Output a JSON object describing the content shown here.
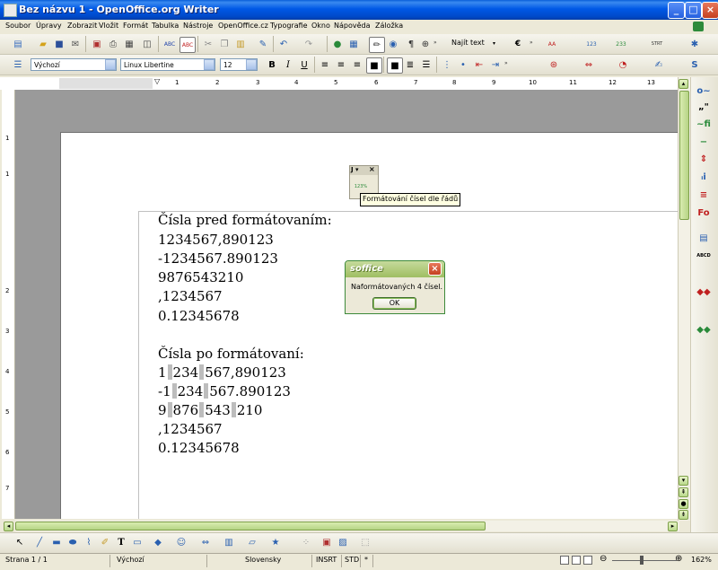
{
  "window": {
    "title": "Bez názvu 1 - OpenOffice.org Writer",
    "controls": [
      "_",
      "□",
      "×"
    ]
  },
  "menu": [
    "Soubor",
    "Úpravy",
    "Zobrazit",
    "Vložit",
    "Formát",
    "Tabulka",
    "Nástroje",
    "OpenOffice.cz",
    "Typografie",
    "Okno",
    "Nápověda",
    "Záložka"
  ],
  "toolbar": {
    "find_text": "Najít text",
    "paragraph_style": "Výchozí",
    "font_name": "Linux Libertine",
    "font_size": "12",
    "bold": "B",
    "italic": "I",
    "underline": "U"
  },
  "ruler": {
    "numbers": [
      "1",
      "2",
      "3",
      "4",
      "5",
      "6",
      "7",
      "8",
      "9",
      "10",
      "11",
      "12",
      "13"
    ],
    "vnumbers": [
      "1",
      "1",
      "2",
      "3",
      "4",
      "5",
      "6",
      "7"
    ]
  },
  "document": {
    "heading_before": "Čísla pred formátovaním:",
    "before": [
      "1234567,890123",
      "-1234567.890123",
      "9876543210",
      ",1234567",
      "0.12345678"
    ],
    "heading_after": "Čísla po formátovaní:",
    "after": [
      {
        "parts": [
          "1",
          "234",
          "567,890123"
        ]
      },
      {
        "parts": [
          "-1",
          "234",
          "567.890123"
        ]
      },
      {
        "parts": [
          "9",
          "876",
          "543",
          "210"
        ]
      },
      {
        "parts": [
          ",1234567"
        ]
      },
      {
        "parts": [
          "0.12345678"
        ]
      }
    ]
  },
  "floating_toolbar": {
    "icon_label": "123%",
    "tooltip": "Formátování čísel dle řádů"
  },
  "dialog": {
    "title": "soffice",
    "message": "Naformátovaných 4 čísel.",
    "ok": "OK"
  },
  "statusbar": {
    "page": "Strana 1 / 1",
    "style": "Výchozí",
    "language": "Slovensky",
    "insert_mode": "INSRT",
    "selection_mode": "STD",
    "modified": "*",
    "zoom": "162%"
  }
}
